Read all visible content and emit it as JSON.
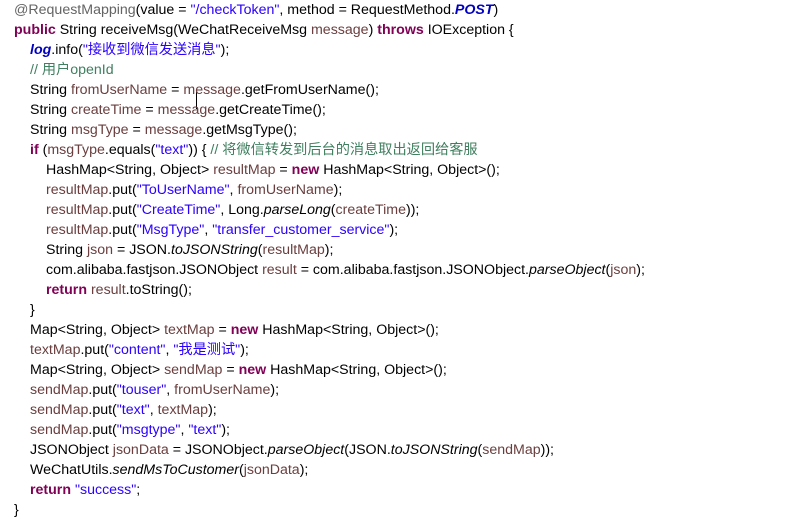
{
  "editor": {
    "lines": [
      {
        "indent": 1,
        "tokens": [
          {
            "t": "@RequestMapping",
            "c": "ann"
          },
          {
            "t": "(value = "
          },
          {
            "t": "\"/checkToken\"",
            "c": "str"
          },
          {
            "t": ", method = RequestMethod."
          },
          {
            "t": "POST",
            "c": "fld"
          },
          {
            "t": ")"
          }
        ]
      },
      {
        "indent": 1,
        "tokens": [
          {
            "t": "public",
            "c": "kw"
          },
          {
            "t": " String receiveMsg(WeChatReceiveMsg "
          },
          {
            "t": "message",
            "c": "var"
          },
          {
            "t": ") "
          },
          {
            "t": "throws",
            "c": "kw"
          },
          {
            "t": " IOException {"
          }
        ]
      },
      {
        "indent": 2,
        "tokens": [
          {
            "t": "log",
            "c": "fld"
          },
          {
            "t": ".info("
          },
          {
            "t": "\"接收到微信发送消息\"",
            "c": "str"
          },
          {
            "t": ");"
          }
        ]
      },
      {
        "indent": 2,
        "tokens": [
          {
            "t": "// 用户openId",
            "c": "cm"
          }
        ]
      },
      {
        "indent": 2,
        "tokens": [
          {
            "t": "String "
          },
          {
            "t": "fromUserName",
            "c": "var"
          },
          {
            "t": " = "
          },
          {
            "t": "message",
            "c": "var"
          },
          {
            "t": ".getFromUserName();"
          }
        ]
      },
      {
        "indent": 2,
        "tokens": [
          {
            "t": "String "
          },
          {
            "t": "createTime",
            "c": "var"
          },
          {
            "t": " = "
          },
          {
            "t": "message",
            "c": "var"
          },
          {
            "t": ".getCreateTime();"
          }
        ]
      },
      {
        "indent": 2,
        "tokens": [
          {
            "t": "String "
          },
          {
            "t": "msgType",
            "c": "var"
          },
          {
            "t": " = "
          },
          {
            "t": "message",
            "c": "var"
          },
          {
            "t": ".getMsgType();"
          }
        ]
      },
      {
        "indent": 2,
        "tokens": [
          {
            "t": "if",
            "c": "kw"
          },
          {
            "t": " ("
          },
          {
            "t": "msgType",
            "c": "var"
          },
          {
            "t": ".equals("
          },
          {
            "t": "\"text\"",
            "c": "str"
          },
          {
            "t": ")) { "
          },
          {
            "t": "// 将微信转发到后台的消息取出返回给客服",
            "c": "cm"
          }
        ]
      },
      {
        "indent": 3,
        "tokens": [
          {
            "t": "HashMap<String, Object> "
          },
          {
            "t": "resultMap",
            "c": "var"
          },
          {
            "t": " = "
          },
          {
            "t": "new",
            "c": "kw"
          },
          {
            "t": " HashMap<String, Object>();"
          }
        ]
      },
      {
        "indent": 3,
        "tokens": [
          {
            "t": "resultMap",
            "c": "var"
          },
          {
            "t": ".put("
          },
          {
            "t": "\"ToUserName\"",
            "c": "str"
          },
          {
            "t": ", "
          },
          {
            "t": "fromUserName",
            "c": "var"
          },
          {
            "t": ");"
          }
        ]
      },
      {
        "indent": 3,
        "tokens": [
          {
            "t": "resultMap",
            "c": "var"
          },
          {
            "t": ".put("
          },
          {
            "t": "\"CreateTime\"",
            "c": "str"
          },
          {
            "t": ", Long."
          },
          {
            "t": "parseLong",
            "c": "sm"
          },
          {
            "t": "("
          },
          {
            "t": "createTime",
            "c": "var"
          },
          {
            "t": "));"
          }
        ]
      },
      {
        "indent": 3,
        "tokens": [
          {
            "t": "resultMap",
            "c": "var"
          },
          {
            "t": ".put("
          },
          {
            "t": "\"MsgType\"",
            "c": "str"
          },
          {
            "t": ", "
          },
          {
            "t": "\"transfer_customer_service\"",
            "c": "str"
          },
          {
            "t": ");"
          }
        ]
      },
      {
        "indent": 3,
        "tokens": [
          {
            "t": "String "
          },
          {
            "t": "json",
            "c": "var"
          },
          {
            "t": " = JSON."
          },
          {
            "t": "toJSONString",
            "c": "sm"
          },
          {
            "t": "("
          },
          {
            "t": "resultMap",
            "c": "var"
          },
          {
            "t": ");"
          }
        ]
      },
      {
        "indent": 3,
        "tokens": [
          {
            "t": "com.alibaba.fastjson.JSONObject "
          },
          {
            "t": "result",
            "c": "var"
          },
          {
            "t": " = com.alibaba.fastjson.JSONObject."
          },
          {
            "t": "parseObject",
            "c": "sm"
          },
          {
            "t": "("
          },
          {
            "t": "json",
            "c": "var"
          },
          {
            "t": ");"
          }
        ]
      },
      {
        "indent": 3,
        "tokens": [
          {
            "t": "return",
            "c": "kw"
          },
          {
            "t": " "
          },
          {
            "t": "result",
            "c": "var"
          },
          {
            "t": ".toString();"
          }
        ]
      },
      {
        "indent": 2,
        "tokens": [
          {
            "t": "}"
          }
        ]
      },
      {
        "indent": 2,
        "tokens": [
          {
            "t": "Map<String, Object> "
          },
          {
            "t": "textMap",
            "c": "var"
          },
          {
            "t": " = "
          },
          {
            "t": "new",
            "c": "kw"
          },
          {
            "t": " HashMap<String, Object>();"
          }
        ]
      },
      {
        "indent": 2,
        "tokens": [
          {
            "t": "textMap",
            "c": "var"
          },
          {
            "t": ".put("
          },
          {
            "t": "\"content\"",
            "c": "str"
          },
          {
            "t": ", "
          },
          {
            "t": "\"我是测试\"",
            "c": "str"
          },
          {
            "t": ");"
          }
        ]
      },
      {
        "indent": 2,
        "tokens": [
          {
            "t": "Map<String, Object> "
          },
          {
            "t": "sendMap",
            "c": "var"
          },
          {
            "t": " = "
          },
          {
            "t": "new",
            "c": "kw"
          },
          {
            "t": " HashMap<String, Object>();"
          }
        ]
      },
      {
        "indent": 2,
        "tokens": [
          {
            "t": "sendMap",
            "c": "var"
          },
          {
            "t": ".put("
          },
          {
            "t": "\"touser\"",
            "c": "str"
          },
          {
            "t": ", "
          },
          {
            "t": "fromUserName",
            "c": "var"
          },
          {
            "t": ");"
          }
        ]
      },
      {
        "indent": 2,
        "tokens": [
          {
            "t": "sendMap",
            "c": "var"
          },
          {
            "t": ".put("
          },
          {
            "t": "\"text\"",
            "c": "str"
          },
          {
            "t": ", "
          },
          {
            "t": "textMap",
            "c": "var"
          },
          {
            "t": ");"
          }
        ]
      },
      {
        "indent": 2,
        "tokens": [
          {
            "t": "sendMap",
            "c": "var"
          },
          {
            "t": ".put("
          },
          {
            "t": "\"msgtype\"",
            "c": "str"
          },
          {
            "t": ", "
          },
          {
            "t": "\"text\"",
            "c": "str"
          },
          {
            "t": ");"
          }
        ]
      },
      {
        "indent": 2,
        "tokens": [
          {
            "t": "JSONObject "
          },
          {
            "t": "jsonData",
            "c": "var"
          },
          {
            "t": " = JSONObject."
          },
          {
            "t": "parseObject",
            "c": "sm"
          },
          {
            "t": "(JSON."
          },
          {
            "t": "toJSONString",
            "c": "sm"
          },
          {
            "t": "("
          },
          {
            "t": "sendMap",
            "c": "var"
          },
          {
            "t": "));"
          }
        ]
      },
      {
        "indent": 2,
        "tokens": [
          {
            "t": "WeChatUtils."
          },
          {
            "t": "sendMsToCustomer",
            "c": "sm"
          },
          {
            "t": "("
          },
          {
            "t": "jsonData",
            "c": "var"
          },
          {
            "t": ");"
          }
        ]
      },
      {
        "indent": 2,
        "tokens": [
          {
            "t": "return",
            "c": "kw"
          },
          {
            "t": " "
          },
          {
            "t": "\"success\"",
            "c": "str"
          },
          {
            "t": ";"
          }
        ]
      },
      {
        "indent": 1,
        "tokens": [
          {
            "t": "}"
          }
        ]
      }
    ]
  }
}
